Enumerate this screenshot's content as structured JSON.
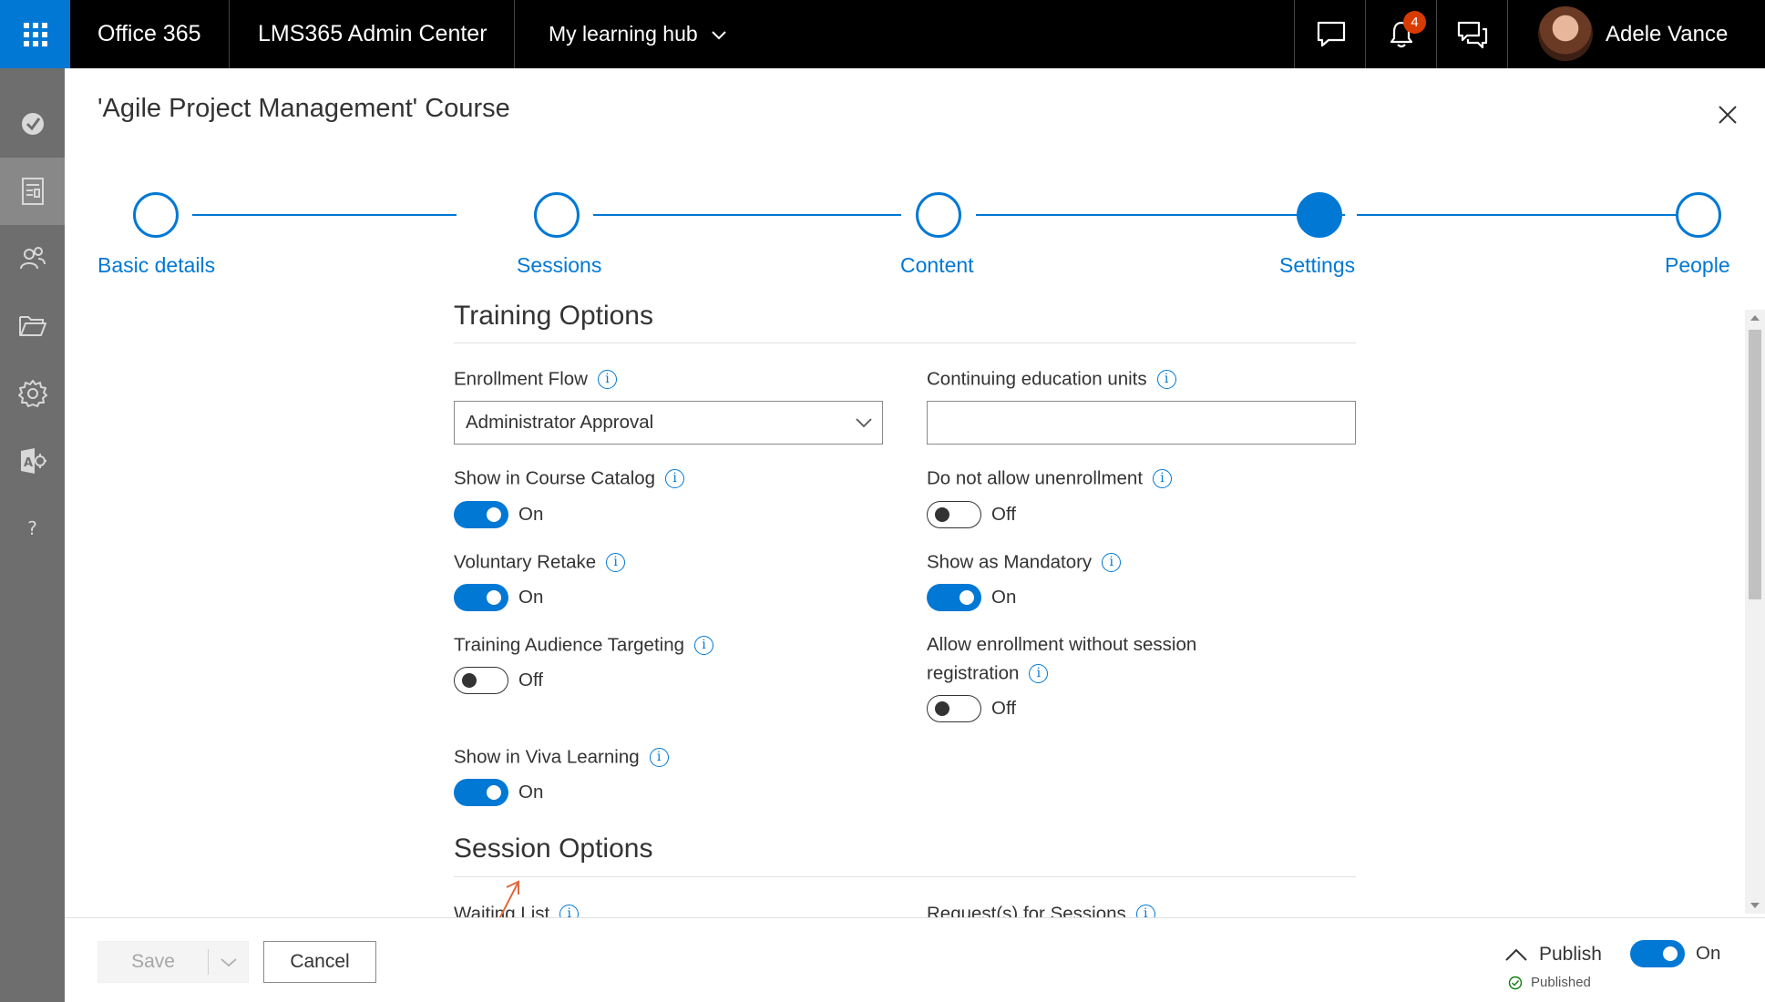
{
  "topbar": {
    "app_name": "Office 365",
    "admin_center": "LMS365 Admin Center",
    "hub_menu": "My learning hub",
    "notification_count": "4",
    "user_name": "Adele Vance"
  },
  "panel": {
    "title": "'Agile Project Management' Course"
  },
  "steps": [
    {
      "label": "Basic details",
      "state": "incomplete"
    },
    {
      "label": "Sessions",
      "state": "incomplete"
    },
    {
      "label": "Content",
      "state": "incomplete"
    },
    {
      "label": "Settings",
      "state": "current"
    },
    {
      "label": "People",
      "state": "incomplete"
    }
  ],
  "training_options": {
    "title": "Training Options",
    "enrollment_flow": {
      "label": "Enrollment Flow",
      "value": "Administrator Approval"
    },
    "ceu": {
      "label": "Continuing education units",
      "value": ""
    },
    "show_in_catalog": {
      "label": "Show in Course Catalog",
      "state": "On"
    },
    "no_unenrollment": {
      "label": "Do not allow unenrollment",
      "state": "Off"
    },
    "voluntary_retake": {
      "label": "Voluntary Retake",
      "state": "On"
    },
    "show_as_mandatory": {
      "label": "Show as Mandatory",
      "state": "On"
    },
    "audience_targeting": {
      "label": "Training Audience Targeting",
      "state": "Off"
    },
    "enroll_without_session": {
      "label_line1": "Allow enrollment without session",
      "label_line2": "registration",
      "state": "Off"
    },
    "viva_learning": {
      "label": "Show in Viva Learning",
      "state": "On"
    }
  },
  "session_options": {
    "title": "Session Options",
    "waiting_list": {
      "label": "Waiting List"
    },
    "requests": {
      "label": "Request(s) for Sessions"
    }
  },
  "footer": {
    "save_label": "Save",
    "cancel_label": "Cancel",
    "publish_label": "Publish",
    "publish_state": "On",
    "published_status": "Published"
  },
  "colors": {
    "accent": "#0078d4",
    "topbar": "#000000",
    "leftnav": "#6e6e6e",
    "annotation_arrow": "#e06a3c"
  }
}
